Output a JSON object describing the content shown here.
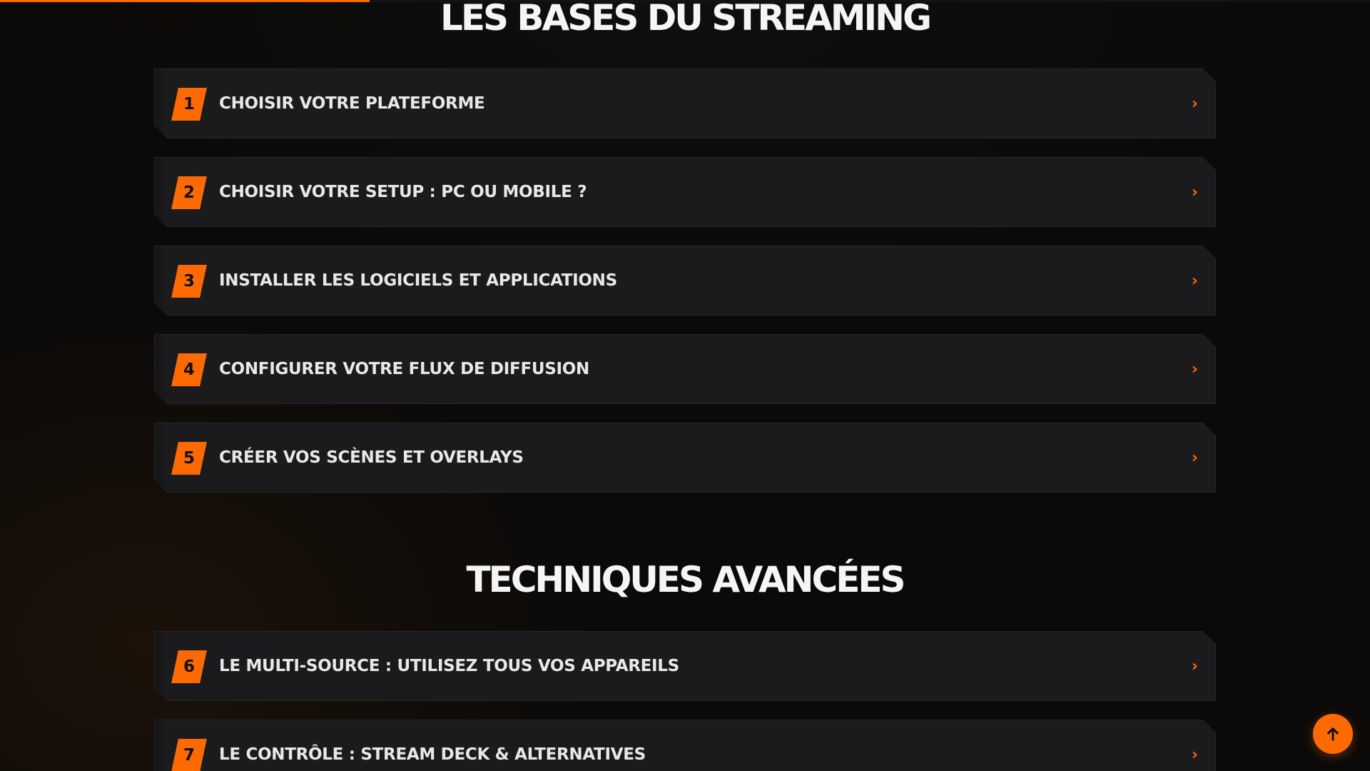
{
  "scroll_progress": 0.27,
  "colors": {
    "accent": "#ff6a00",
    "background": "#0b0a09",
    "card": "#1b1b1d",
    "text": "#e8e8e8"
  },
  "sections": [
    {
      "title": "LES BASES DU STREAMING",
      "items": [
        {
          "number": "1",
          "label": "CHOISIR VOTRE PLATEFORME",
          "icon": "chevron-right-icon"
        },
        {
          "number": "2",
          "label": "CHOISIR VOTRE SETUP : PC OU MOBILE ?",
          "icon": "chevron-right-icon"
        },
        {
          "number": "3",
          "label": "INSTALLER LES LOGICIELS ET APPLICATIONS",
          "icon": "chevron-right-icon"
        },
        {
          "number": "4",
          "label": "CONFIGURER VOTRE FLUX DE DIFFUSION",
          "icon": "chevron-right-icon"
        },
        {
          "number": "5",
          "label": "CRÉER VOS SCÈNES ET OVERLAYS",
          "icon": "chevron-right-icon"
        }
      ]
    },
    {
      "title": "TECHNIQUES AVANCÉES",
      "items": [
        {
          "number": "6",
          "label": "LE MULTI-SOURCE : UTILISEZ TOUS VOS APPAREILS",
          "icon": "chevron-right-icon"
        },
        {
          "number": "7",
          "label": "LE CONTRÔLE : STREAM DECK & ALTERNATIVES",
          "icon": "chevron-right-icon"
        }
      ]
    }
  ],
  "back_to_top": {
    "icon": "arrow-up-icon"
  }
}
